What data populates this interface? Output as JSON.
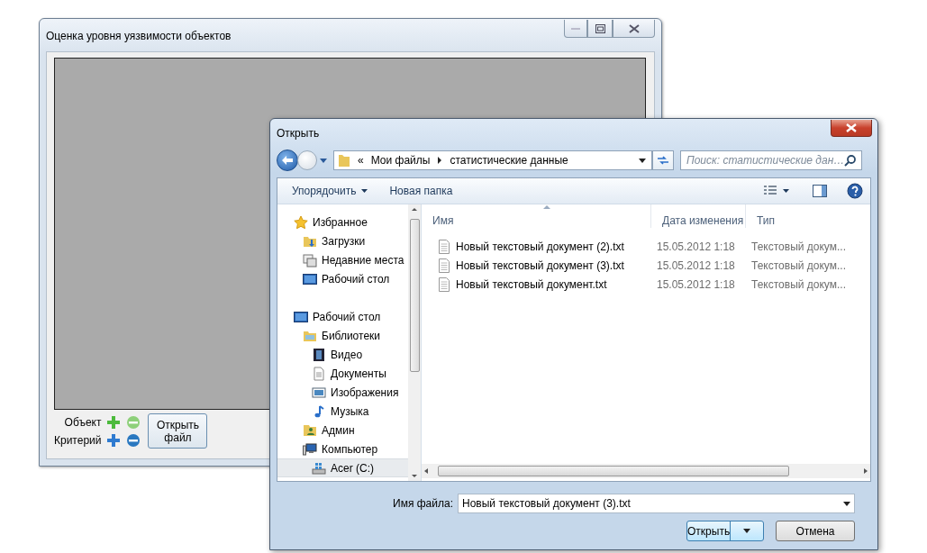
{
  "main_window": {
    "title": "Оценка уровня уязвимости объектов",
    "rows": [
      {
        "label": "Объект",
        "kind": "object"
      },
      {
        "label": "Критерий",
        "kind": "criterion"
      }
    ],
    "open_file_button": "Открыть файл"
  },
  "open_dialog": {
    "title": "Открыть",
    "address": {
      "overflow": "«",
      "path": [
        "Мои файлы",
        "статистические данные"
      ]
    },
    "search": {
      "placeholder": "Поиск: статистические дан…"
    },
    "toolbar": {
      "organize": "Упорядочить",
      "new_folder": "Новая папка"
    },
    "sidebar": {
      "items": [
        {
          "label": "Избранное",
          "kind": "star",
          "selected": false,
          "children": [
            {
              "label": "Загрузки",
              "kind": "downloads",
              "selected": false
            },
            {
              "label": "Недавние места",
              "kind": "recent",
              "selected": false
            },
            {
              "label": "Рабочий стол",
              "kind": "desktop",
              "selected": false
            }
          ]
        },
        {
          "label": "Рабочий стол",
          "kind": "desktop",
          "selected": false,
          "children": [
            {
              "label": "Библиотеки",
              "kind": "library",
              "selected": false,
              "children": [
                {
                  "label": "Видео",
                  "kind": "video",
                  "selected": false
                },
                {
                  "label": "Документы",
                  "kind": "document",
                  "selected": false
                },
                {
                  "label": "Изображения",
                  "kind": "picture",
                  "selected": false
                },
                {
                  "label": "Музыка",
                  "kind": "music",
                  "selected": false
                }
              ]
            },
            {
              "label": "Админ",
              "kind": "user",
              "selected": false
            },
            {
              "label": "Компьютер",
              "kind": "computer",
              "selected": false,
              "children": [
                {
                  "label": "Acer (C:)",
                  "kind": "drive",
                  "selected": true
                }
              ]
            }
          ]
        }
      ]
    },
    "table": {
      "columns": [
        "Имя",
        "Дата изменения",
        "Тип"
      ],
      "rows": [
        {
          "name": "Новый текстовый документ (2).txt",
          "date": "15.05.2012 1:18",
          "type": "Текстовый докум..."
        },
        {
          "name": "Новый текстовый документ (3).txt",
          "date": "15.05.2012 1:18",
          "type": "Текстовый докум..."
        },
        {
          "name": "Новый текстовый документ.txt",
          "date": "15.05.2012 1:18",
          "type": "Текстовый докум..."
        }
      ]
    },
    "filename": {
      "label": "Имя файла:",
      "value": "Новый текстовый документ (3).txt"
    },
    "buttons": {
      "open": "Открыть",
      "cancel": "Отмена"
    }
  }
}
